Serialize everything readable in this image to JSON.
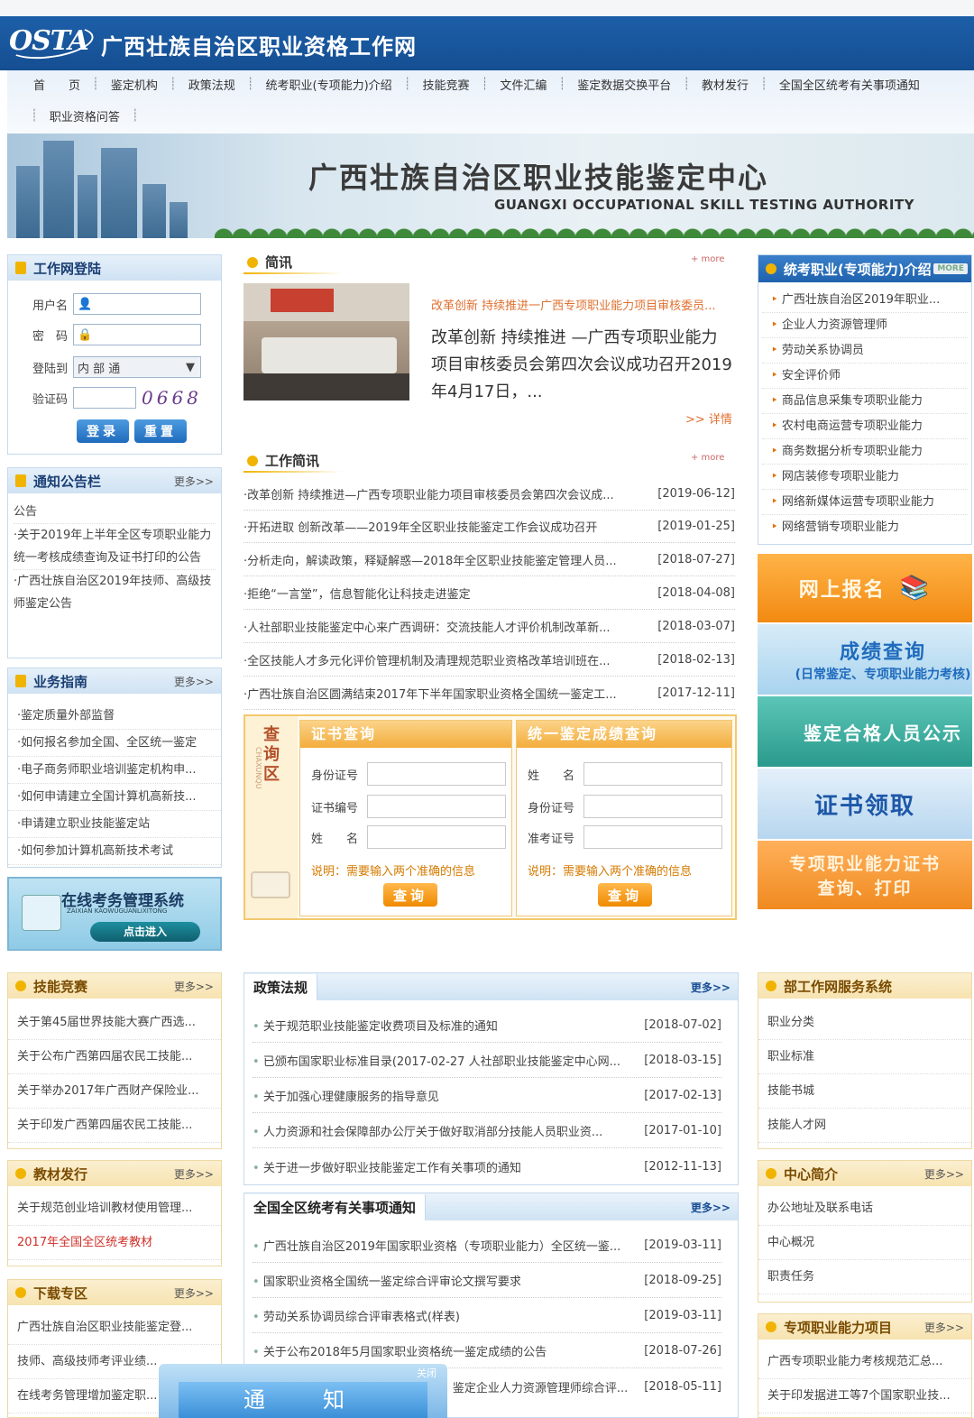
{
  "header": {
    "logo": "OSTA",
    "title": "广西壮族自治区职业资格工作网"
  },
  "nav": {
    "row1": [
      "首　　页",
      "鉴定机构",
      "政策法规",
      "统考职业(专项能力)介绍",
      "技能竞赛",
      "文件汇编",
      "鉴定数据交换平台",
      "教材发行",
      "全国全区统考有关事项通知"
    ],
    "row2": [
      "职业资格问答"
    ]
  },
  "banner": {
    "title_cn": "广西壮族自治区职业技能鉴定中心",
    "title_en": "GUANGXI OCCUPATIONAL SKILL TESTING AUTHORITY"
  },
  "login": {
    "title": "工作网登陆",
    "username_label": "用户名",
    "password_label": "密　码",
    "login_to_label": "登陆到",
    "login_to_value": "内 部 通",
    "captcha_label": "验证码",
    "captcha": "0668",
    "login_btn": "登录",
    "reset_btn": "重置"
  },
  "notice": {
    "title": "通知公告栏",
    "more": "更多>>",
    "items": [
      "公告",
      "·关于2019年上半年全区专项职业能力统一考核成绩查询及证书打印的公告",
      "·广西壮族自治区2019年技师、高级技师鉴定公告"
    ]
  },
  "guide": {
    "title": "业务指南",
    "more": "更多>>",
    "items": [
      "·鉴定质量外部监督",
      "·如何报名参加全国、全区统一鉴定",
      "·电子商务师职业培训鉴定机构申...",
      "·如何申请建立全国计算机高新技...",
      "·申请建立职业技能鉴定站",
      "·如何参加计算机高新技术考试"
    ]
  },
  "exam_system": {
    "title": "在线考务管理系统",
    "subtitle": "ZAIXIAN KAOWUGUANLIXITONG",
    "btn": "点击进入"
  },
  "brief": {
    "title": "简讯",
    "more": "+ more",
    "headline": "改革创新 持续推进一广西专项职业能力项目审核委员...",
    "body": "改革创新 持续推进 —广西专项职业能力项目审核委员会第四次会议成功召开2019年4月17日，...",
    "detail": ">> 详情"
  },
  "work_news": {
    "title": "工作简讯",
    "more": "+ more",
    "rows": [
      {
        "t": "·改革创新 持续推进—广西专项职业能力项目审核委员会第四次会议成...",
        "d": "[2019-06-12]"
      },
      {
        "t": "·开拓进取 创新改革——2019年全区职业技能鉴定工作会议成功召开",
        "d": "[2019-01-25]"
      },
      {
        "t": "·分析走向，解读政策，释疑解惑—2018年全区职业技能鉴定管理人员...",
        "d": "[2018-07-27]"
      },
      {
        "t": "·拒绝“一言堂”，信息智能化让科技走进鉴定",
        "d": "[2018-04-08]"
      },
      {
        "t": "·人社部职业技能鉴定中心来广西调研：交流技能人才评价机制改革新...",
        "d": "[2018-03-07]"
      },
      {
        "t": "·全区技能人才多元化评价管理机制及清理规范职业资格改革培训班在...",
        "d": "[2018-02-13]"
      },
      {
        "t": "·广西壮族自治区圆满结束2017年下半年国家职业资格全国统一鉴定工...",
        "d": "[2017-12-11]"
      }
    ]
  },
  "query": {
    "side": "查询区",
    "side_en": "CHAXUNQU",
    "cert": {
      "title": "证书查询",
      "labels": [
        "身份证号",
        "证书编号",
        "姓　　名"
      ],
      "note": "说明：需要输入两个准确的信息",
      "btn": "查询"
    },
    "score": {
      "title": "统一鉴定成绩查询",
      "labels": [
        "姓　　名",
        "身份证号",
        "准考证号"
      ],
      "note": "说明：需要输入两个准确的信息",
      "btn": "查询"
    }
  },
  "exam_intro": {
    "title": "统考职业(专项能力)介绍",
    "more": "MORE",
    "items": [
      "广西壮族自治区2019年职业...",
      "企业人力资源管理师",
      "劳动关系协调员",
      "安全评价师",
      "商品信息采集专项职业能力",
      "农村电商运营专项职业能力",
      "商务数据分析专项职业能力",
      "网店装修专项职业能力",
      "网络新媒体运营专项职业能力",
      "网络营销专项职业能力"
    ]
  },
  "side_buttons": {
    "online_register": "网上报名",
    "score_query": "成绩查询",
    "score_query_sub": "(日常鉴定、专项职业能力考核)",
    "qualified": "鉴定合格人员公示",
    "cert_collect": "证书领取",
    "special_cert": "专项职业能力证书",
    "special_cert_sub": "查询、打印"
  },
  "skills": {
    "title": "技能竞赛",
    "more": "更多>>",
    "items": [
      "关于第45届世界技能大赛广西选...",
      "关于公布广西第四届农民工技能...",
      "关于举办2017年广西财产保险业...",
      "关于印发广西第四届农民工技能..."
    ]
  },
  "textbook": {
    "title": "教材发行",
    "more": "更多>>",
    "items": [
      "关于规范创业培训教材使用管理...",
      "2017年全国全区统考教材"
    ]
  },
  "download": {
    "title": "下载专区",
    "more": "更多>>",
    "items": [
      "广西壮族自治区职业技能鉴定登...",
      "技师、高级技师考评业绩...",
      "在线考务管理增加鉴定职..."
    ]
  },
  "policy": {
    "title": "政策法规",
    "more": "更多>>",
    "rows": [
      {
        "t": "关于规范职业技能鉴定收费项目及标准的通知",
        "d": "[2018-07-02]"
      },
      {
        "t": "已颁布国家职业标准目录(2017-02-27 人社部职业技能鉴定中心网...",
        "d": "[2018-03-15]"
      },
      {
        "t": "关于加强心理健康服务的指导意见",
        "d": "[2017-02-13]"
      },
      {
        "t": "人力资源和社会保障部办公厅关于做好取消部分技能人员职业资...",
        "d": "[2017-01-10]"
      },
      {
        "t": "关于进一步做好职业技能鉴定工作有关事项的通知",
        "d": "[2012-11-13]"
      }
    ]
  },
  "notices": {
    "title": "全国全区统考有关事项通知",
    "more": "更多>>",
    "rows": [
      {
        "t": "广西壮族自治区2019年国家职业资格（专项职业能力）全区统一鉴...",
        "d": "[2019-03-11]"
      },
      {
        "t": "国家职业资格全国统一鉴定综合评审论文撰写要求",
        "d": "[2018-09-25]"
      },
      {
        "t": "劳动关系协调员综合评审表格式(样表)",
        "d": "[2019-03-11]"
      },
      {
        "t": "关于公布2018年5月国家职业资格统一鉴定成绩的公告",
        "d": "[2018-07-26]"
      },
      {
        "t": "鉴定企业人力资源管理师综合评...",
        "d": "[2018-05-11]"
      }
    ]
  },
  "service": {
    "title": "部工作网服务系统",
    "items": [
      "职业分类",
      "职业标准",
      "技能书城",
      "技能人才网"
    ]
  },
  "center": {
    "title": "中心简介",
    "more": "更多>>",
    "items": [
      "办公地址及联系电话",
      "中心概况",
      "职责任务"
    ]
  },
  "special": {
    "title": "专项职业能力项目",
    "more": "更多>>",
    "items": [
      "广西专项职业能力考核规范汇总...",
      "关于印发据进工等7个国家职业技..."
    ]
  },
  "popup": {
    "title": "通　知",
    "close": "关闭"
  }
}
